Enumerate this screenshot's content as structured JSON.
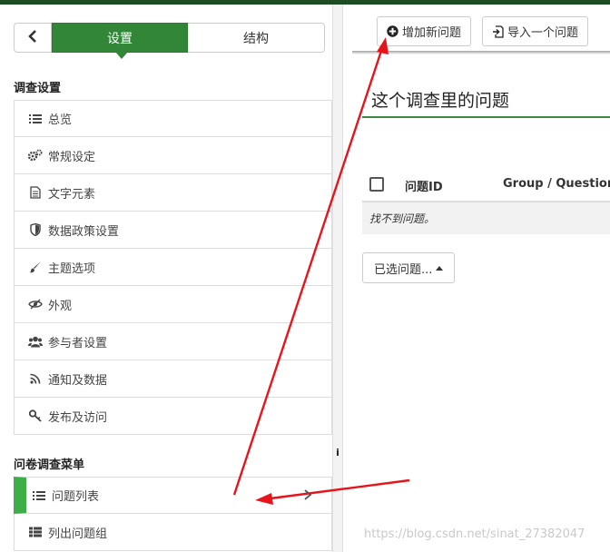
{
  "sidebar": {
    "back_icon": "chevron-left-icon",
    "tabs": [
      {
        "label": "设置",
        "active": true
      },
      {
        "label": "结构",
        "active": false
      }
    ],
    "sections": [
      {
        "title": "调查设置",
        "items": [
          {
            "label": "总览",
            "icon": "list-icon"
          },
          {
            "label": "常规设定",
            "icon": "gears-icon"
          },
          {
            "label": "文字元素",
            "icon": "file-text-icon"
          },
          {
            "label": "数据政策设置",
            "icon": "shield-icon"
          },
          {
            "label": "主题选项",
            "icon": "paint-brush-icon"
          },
          {
            "label": "外观",
            "icon": "eye-slash-icon"
          },
          {
            "label": "参与者设置",
            "icon": "users-icon"
          },
          {
            "label": "通知及数据",
            "icon": "rss-icon"
          },
          {
            "label": "发布及访问",
            "icon": "key-icon"
          }
        ]
      },
      {
        "title": "问卷调查菜单",
        "items": [
          {
            "label": "问题列表",
            "icon": "list-icon",
            "active": true
          },
          {
            "label": "列出问题组",
            "icon": "th-list-icon"
          }
        ]
      }
    ],
    "collapse_glyph": "i"
  },
  "toolbar": {
    "add_question_label": "增加新问题",
    "import_question_label": "导入一个问题"
  },
  "main": {
    "title": "这个调查里的问题",
    "table": {
      "columns": [
        "问题ID",
        "Group / Question o"
      ],
      "empty_message": "找不到问题。"
    },
    "selected_questions_label": "已选问题..."
  },
  "watermark": "https://blog.csdn.net/sinat_27382047",
  "colors": {
    "accent_green": "#328637",
    "active_marker": "#3fae49",
    "topbar": "#1e4d24",
    "annotation_red": "#e8141c"
  }
}
